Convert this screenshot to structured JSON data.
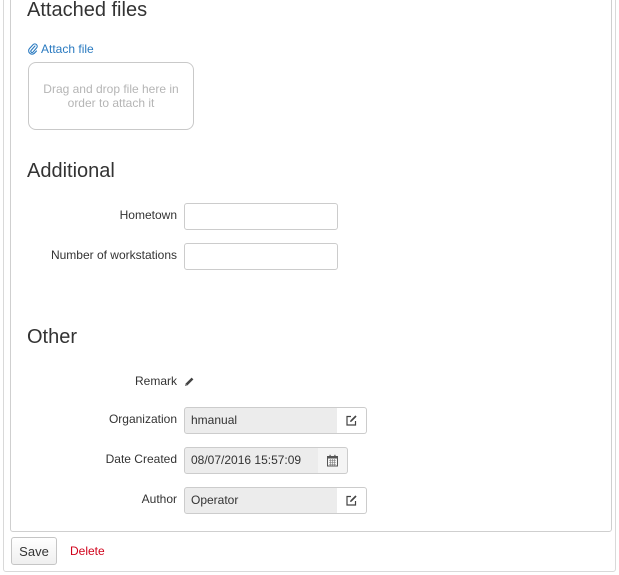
{
  "attached_files": {
    "title": "Attached files",
    "attach_link": "Attach file",
    "dropzone_text": "Drag and drop file here in order to attach it"
  },
  "additional": {
    "title": "Additional",
    "hometown_label": "Hometown",
    "hometown_value": "",
    "workstations_label": "Number of workstations",
    "workstations_value": ""
  },
  "other": {
    "title": "Other",
    "remark_label": "Remark",
    "organization_label": "Organization",
    "organization_value": "hmanual",
    "date_created_label": "Date Created",
    "date_created_value": "08/07/2016 15:57:09",
    "author_label": "Author",
    "author_value": "Operator"
  },
  "footer": {
    "save_label": "Save",
    "delete_label": "Delete"
  },
  "icons": {
    "attach": "paperclip-icon",
    "remark": "pencil-icon",
    "organization": "edit-icon",
    "date": "calendar-icon",
    "author": "edit-icon"
  },
  "colors": {
    "link": "#2a7ac0",
    "delete": "#d0021b",
    "readonly_bg": "#ececec"
  }
}
